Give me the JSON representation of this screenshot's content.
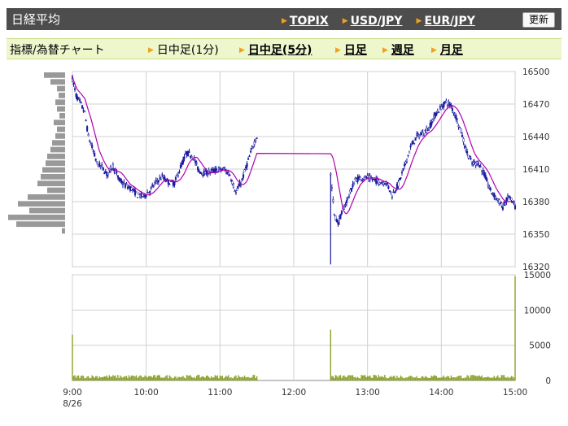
{
  "header": {
    "title": "日経平均",
    "links": [
      "TOPIX",
      "USD/JPY",
      "EUR/JPY"
    ],
    "refresh_label": "更新"
  },
  "subheader": {
    "label": "指標/為替チャート",
    "tabs": [
      {
        "label": "日中足(1分)",
        "active": false
      },
      {
        "label": "日中足(5分)",
        "active": true
      },
      {
        "label": "日足",
        "active": true
      },
      {
        "label": "週足",
        "active": true
      },
      {
        "label": "月足",
        "active": true
      }
    ]
  },
  "colors": {
    "header_bg": "#4d4d4d",
    "subheader_bg": "#eef6cc",
    "candle_up": "#ffffff",
    "candle_down": "#1a1aa0",
    "moving_average": "#b000b0",
    "volume": "#8aa22a",
    "price_volume_bars": "#999999",
    "grid": "#d0d0d0"
  },
  "chart_data": [
    {
      "type": "candlestick",
      "y_ticks": [
        16500,
        16470,
        16440,
        16410,
        16380,
        16350,
        16320
      ],
      "ylim": [
        16320,
        16500
      ],
      "x_ticks": [
        "9:00",
        "10:00",
        "11:00",
        "12:00",
        "13:00",
        "14:00",
        "15:00"
      ],
      "date_label": "8/26",
      "x_range": [
        "9:00",
        "15:00"
      ],
      "sessions": [
        [
          "9:00",
          "11:30"
        ],
        [
          "12:30",
          "15:00"
        ]
      ],
      "price_path": [
        [
          "9:00",
          16493
        ],
        [
          "9:03",
          16478
        ],
        [
          "9:06",
          16472
        ],
        [
          "9:10",
          16462
        ],
        [
          "9:13",
          16440
        ],
        [
          "9:16",
          16430
        ],
        [
          "9:20",
          16415
        ],
        [
          "9:24",
          16412
        ],
        [
          "9:28",
          16405
        ],
        [
          "9:33",
          16413
        ],
        [
          "9:38",
          16400
        ],
        [
          "9:43",
          16395
        ],
        [
          "9:48",
          16392
        ],
        [
          "9:53",
          16386
        ],
        [
          "9:58",
          16385
        ],
        [
          "10:03",
          16390
        ],
        [
          "10:08",
          16398
        ],
        [
          "10:13",
          16403
        ],
        [
          "10:18",
          16398
        ],
        [
          "10:23",
          16397
        ],
        [
          "10:28",
          16412
        ],
        [
          "10:33",
          16425
        ],
        [
          "10:38",
          16422
        ],
        [
          "10:43",
          16408
        ],
        [
          "10:48",
          16406
        ],
        [
          "10:53",
          16408
        ],
        [
          "10:58",
          16409
        ],
        [
          "11:03",
          16410
        ],
        [
          "11:08",
          16405
        ],
        [
          "11:13",
          16388
        ],
        [
          "11:18",
          16400
        ],
        [
          "11:23",
          16418
        ],
        [
          "11:28",
          16435
        ],
        [
          "11:33",
          16447
        ],
        [
          "11:36",
          16446
        ],
        [
          "11:40",
          16440
        ],
        [
          "12:30",
          16405
        ],
        [
          "12:33",
          16368
        ],
        [
          "12:36",
          16360
        ],
        [
          "12:40",
          16372
        ],
        [
          "12:45",
          16386
        ],
        [
          "12:50",
          16400
        ],
        [
          "12:55",
          16402
        ],
        [
          "13:00",
          16402
        ],
        [
          "13:05",
          16400
        ],
        [
          "13:10",
          16398
        ],
        [
          "13:15",
          16398
        ],
        [
          "13:20",
          16386
        ],
        [
          "13:25",
          16396
        ],
        [
          "13:30",
          16412
        ],
        [
          "13:35",
          16430
        ],
        [
          "13:40",
          16440
        ],
        [
          "13:45",
          16443
        ],
        [
          "13:50",
          16448
        ],
        [
          "13:55",
          16460
        ],
        [
          "14:00",
          16467
        ],
        [
          "14:04",
          16472
        ],
        [
          "14:08",
          16468
        ],
        [
          "14:12",
          16458
        ],
        [
          "14:16",
          16445
        ],
        [
          "14:20",
          16428
        ],
        [
          "14:25",
          16415
        ],
        [
          "14:30",
          16416
        ],
        [
          "14:35",
          16405
        ],
        [
          "14:40",
          16390
        ],
        [
          "14:45",
          16383
        ],
        [
          "14:50",
          16375
        ],
        [
          "14:55",
          16385
        ],
        [
          "15:00",
          16375
        ]
      ],
      "price_volume_profile": [
        16500,
        16350
      ]
    },
    {
      "type": "bar",
      "y_ticks": [
        15000,
        10000,
        5000,
        0
      ],
      "ylim": [
        0,
        15000
      ],
      "spikes": [
        [
          "9:00",
          6500
        ],
        [
          "12:30",
          7200
        ],
        [
          "15:00",
          14800
        ]
      ],
      "baseline_volume": [
        300,
        800
      ]
    }
  ]
}
